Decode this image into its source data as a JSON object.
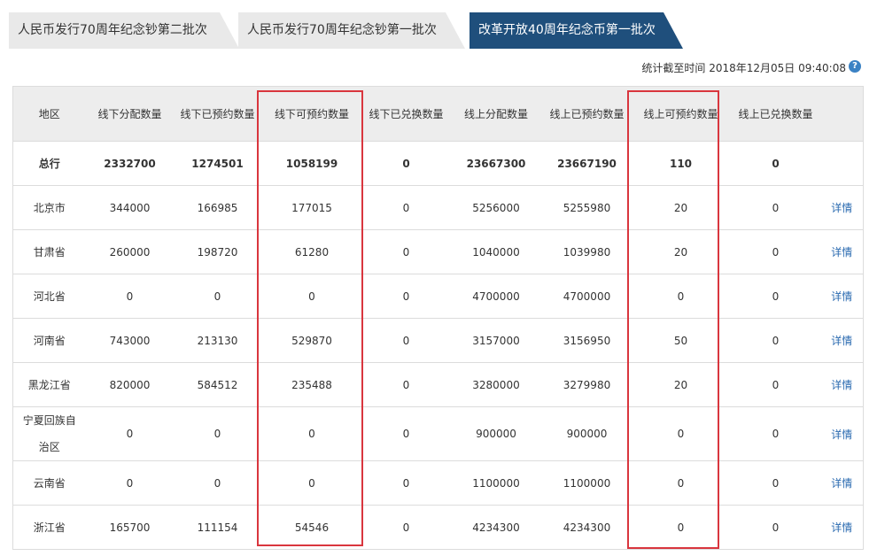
{
  "tabs": [
    {
      "label": "人民币发行70周年纪念钞第二批次"
    },
    {
      "label": "人民币发行70周年纪念钞第一批次"
    },
    {
      "label": "改革开放40周年纪念币第一批次"
    }
  ],
  "stats_text": "统计截至时间 2018年12月05日 09:40:08",
  "help_icon_glyph": "?",
  "columns": [
    "地区",
    "线下分配数量",
    "线下已预约数量",
    "线下可预约数量",
    "线下已兑换数量",
    "线上分配数量",
    "线上已预约数量",
    "线上可预约数量",
    "线上已兑换数量",
    ""
  ],
  "total_row": [
    "总行",
    "2332700",
    "1274501",
    "1058199",
    "0",
    "23667300",
    "23667190",
    "110",
    "0"
  ],
  "rows": [
    {
      "cells": [
        "北京市",
        "344000",
        "166985",
        "177015",
        "0",
        "5256000",
        "5255980",
        "20",
        "0"
      ],
      "link": "详情"
    },
    {
      "cells": [
        "甘肃省",
        "260000",
        "198720",
        "61280",
        "0",
        "1040000",
        "1039980",
        "20",
        "0"
      ],
      "link": "详情"
    },
    {
      "cells": [
        "河北省",
        "0",
        "0",
        "0",
        "0",
        "4700000",
        "4700000",
        "0",
        "0"
      ],
      "link": "详情"
    },
    {
      "cells": [
        "河南省",
        "743000",
        "213130",
        "529870",
        "0",
        "3157000",
        "3156950",
        "50",
        "0"
      ],
      "link": "详情"
    },
    {
      "cells": [
        "黑龙江省",
        "820000",
        "584512",
        "235488",
        "0",
        "3280000",
        "3279980",
        "20",
        "0"
      ],
      "link": "详情"
    },
    {
      "cells": [
        "宁夏回族自治区",
        "0",
        "0",
        "0",
        "0",
        "900000",
        "900000",
        "0",
        "0"
      ],
      "link": "详情"
    },
    {
      "cells": [
        "云南省",
        "0",
        "0",
        "0",
        "0",
        "1100000",
        "1100000",
        "0",
        "0"
      ],
      "link": "详情"
    },
    {
      "cells": [
        "浙江省",
        "165700",
        "111154",
        "54546",
        "0",
        "4234300",
        "4234300",
        "0",
        "0"
      ],
      "link": "详情"
    }
  ]
}
